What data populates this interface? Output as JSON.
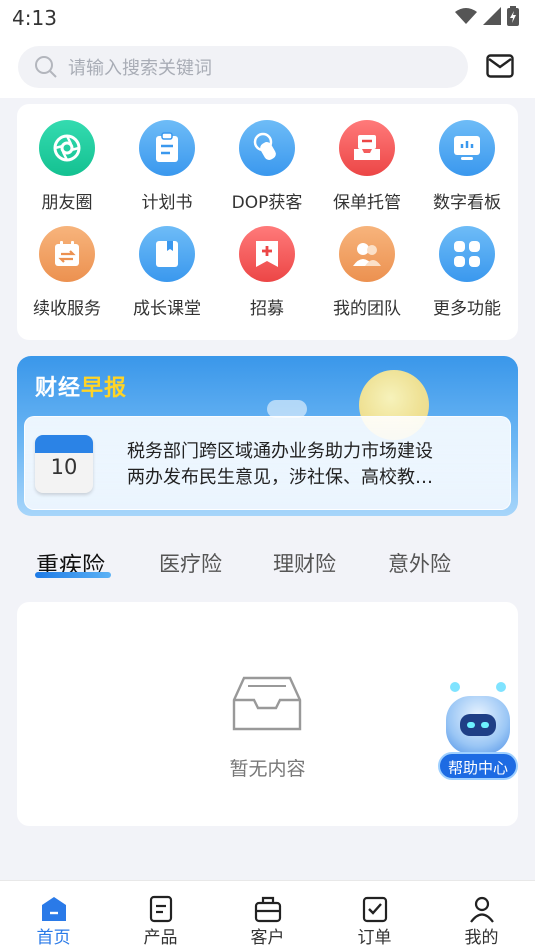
{
  "status_bar": {
    "time": "4:13"
  },
  "search": {
    "placeholder": "请输入搜索关键词"
  },
  "grid": [
    {
      "label": "朋友圈",
      "icon": "aperture-icon",
      "color": "#1fcf9f"
    },
    {
      "label": "计划书",
      "icon": "clipboard-icon",
      "color": "#4aa7f3"
    },
    {
      "label": "DOP获客",
      "icon": "touch-icon",
      "color": "#4aa7f3"
    },
    {
      "label": "保单托管",
      "icon": "inbox-icon",
      "color": "#f25858"
    },
    {
      "label": "数字看板",
      "icon": "dashboard-icon",
      "color": "#4aa7f3"
    },
    {
      "label": "续收服务",
      "icon": "calendar-renew-icon",
      "color": "#f0a264"
    },
    {
      "label": "成长课堂",
      "icon": "book-icon",
      "color": "#4aa7f3"
    },
    {
      "label": "招募",
      "icon": "plus-bookmark-icon",
      "color": "#f25858"
    },
    {
      "label": "我的团队",
      "icon": "team-icon",
      "color": "#f0a264"
    },
    {
      "label": "更多功能",
      "icon": "apps-icon",
      "color": "#4aa7f3"
    }
  ],
  "news": {
    "title_main": "财经",
    "title_highlight": "早报",
    "calendar_day": "10",
    "line1": "税务部门跨区域通办业务助力市场建设",
    "line2": "两办发布民生意见，涉社保、高校教…"
  },
  "tabs": [
    {
      "label": "重疾险",
      "active": true
    },
    {
      "label": "医疗险",
      "active": false
    },
    {
      "label": "理财险",
      "active": false
    },
    {
      "label": "意外险",
      "active": false
    }
  ],
  "empty": {
    "text": "暂无内容"
  },
  "help": {
    "label": "帮助中心"
  },
  "bottom_nav": [
    {
      "label": "首页",
      "icon": "home-icon",
      "active": true
    },
    {
      "label": "产品",
      "icon": "document-icon",
      "active": false
    },
    {
      "label": "客户",
      "icon": "briefcase-icon",
      "active": false
    },
    {
      "label": "订单",
      "icon": "check-square-icon",
      "active": false
    },
    {
      "label": "我的",
      "icon": "user-icon",
      "active": false
    }
  ],
  "colors": {
    "accent": "#2a7ae8",
    "highlight": "#ffd426"
  }
}
